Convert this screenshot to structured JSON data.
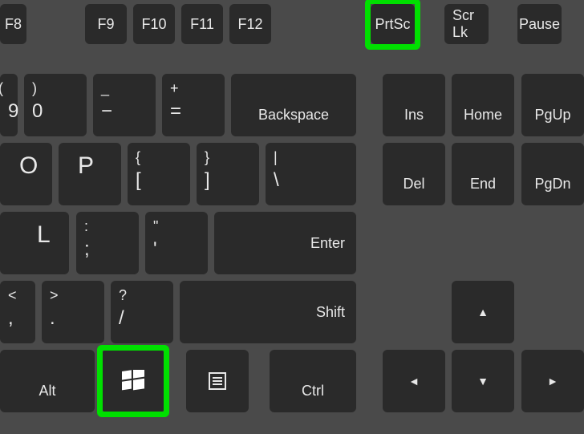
{
  "function_row": {
    "f8": "F8",
    "f9": "F9",
    "f10": "F10",
    "f11": "F11",
    "f12": "F12",
    "prtsc": "PrtSc",
    "scrlk": "Scr Lk",
    "pause": "Pause"
  },
  "number_row": {
    "nine_upper": "(",
    "nine_lower": "9",
    "zero_upper": ")",
    "zero_lower": "0",
    "minus_upper": "_",
    "minus_lower": "−",
    "equals_upper": "+",
    "equals_lower": "=",
    "backspace": "Backspace",
    "ins": "Ins",
    "home": "Home",
    "pgup": "PgUp"
  },
  "qwerty_row": {
    "o": "O",
    "p": "P",
    "lbracket_upper": "{",
    "lbracket_lower": "[",
    "rbracket_upper": "}",
    "rbracket_lower": "]",
    "backslash_upper": "|",
    "backslash_lower": "\\",
    "del": "Del",
    "end": "End",
    "pgdn": "PgDn"
  },
  "home_row": {
    "l": "L",
    "semicolon_upper": ":",
    "semicolon_lower": ";",
    "quote_upper": "\"",
    "quote_lower": "'",
    "enter": "Enter"
  },
  "shift_row": {
    "comma_upper": "<",
    "comma_lower": ",",
    "period_upper": ">",
    "period_lower": ".",
    "slash_upper": "?",
    "slash_lower": "/",
    "shift": "Shift",
    "up": "▲"
  },
  "bottom_row": {
    "alt": "Alt",
    "ctrl": "Ctrl",
    "left": "◄",
    "down": "▼",
    "right": "►"
  },
  "highlighted_keys": [
    "prtsc",
    "windows"
  ]
}
